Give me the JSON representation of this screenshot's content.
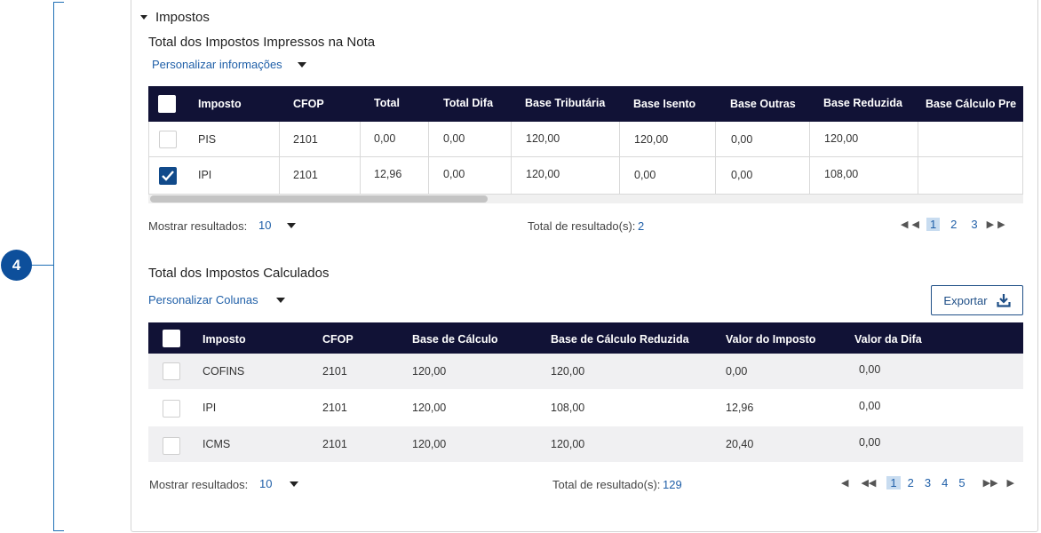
{
  "step_badge": "4",
  "section": {
    "title": "Impostos"
  },
  "printed": {
    "title": "Total dos Impostos Impressos na Nota",
    "customize_label": "Personalizar informações",
    "columns": [
      "Imposto",
      "CFOP",
      "Total",
      "Total Difa",
      "Base Tributária",
      "Base Isento",
      "Base Outras",
      "Base Reduzida",
      "Base Cálculo Pre"
    ],
    "rows": [
      {
        "checked": false,
        "cells": [
          "PIS",
          "2101",
          "0,00",
          "0,00",
          "120,00",
          "120,00",
          "0,00",
          "120,00",
          ""
        ]
      },
      {
        "checked": true,
        "cells": [
          "IPI",
          "2101",
          "12,96",
          "0,00",
          "120,00",
          "0,00",
          "0,00",
          "108,00",
          ""
        ]
      }
    ],
    "show_results_label": "Mostrar resultados:",
    "page_size": "10",
    "total_label": "Total de resultado(s):",
    "total_value": "2",
    "pages": [
      "1",
      "2",
      "3"
    ],
    "current_page": "1"
  },
  "calculated": {
    "title": "Total dos Impostos Calculados",
    "customize_label": "Personalizar Colunas",
    "export_label": "Exportar",
    "columns": [
      "Imposto",
      "CFOP",
      "Base de Cálculo",
      "Base de Cálculo Reduzida",
      "Valor do Imposto",
      "Valor da Difa"
    ],
    "rows": [
      {
        "checked": false,
        "cells": [
          "COFINS",
          "2101",
          "120,00",
          "120,00",
          "0,00",
          "0,00"
        ]
      },
      {
        "checked": false,
        "cells": [
          "IPI",
          "2101",
          "120,00",
          "108,00",
          "12,96",
          "0,00"
        ]
      },
      {
        "checked": false,
        "cells": [
          "ICMS",
          "2101",
          "120,00",
          "120,00",
          "20,40",
          "0,00"
        ]
      }
    ],
    "show_results_label": "Mostrar resultados:",
    "page_size": "10",
    "total_label": "Total de resultado(s):",
    "total_value": "129",
    "pages": [
      "1",
      "2",
      "3",
      "4",
      "5"
    ],
    "current_page": "1"
  },
  "colors": {
    "header_bg": "#111236",
    "accent": "#1f5fa8",
    "badge": "#0d4f9b",
    "checkbox_on": "#114a8a"
  },
  "icons": {
    "section_toggle": "triangle-down-icon",
    "dropdown": "caret-down-icon",
    "export": "download-icon"
  }
}
